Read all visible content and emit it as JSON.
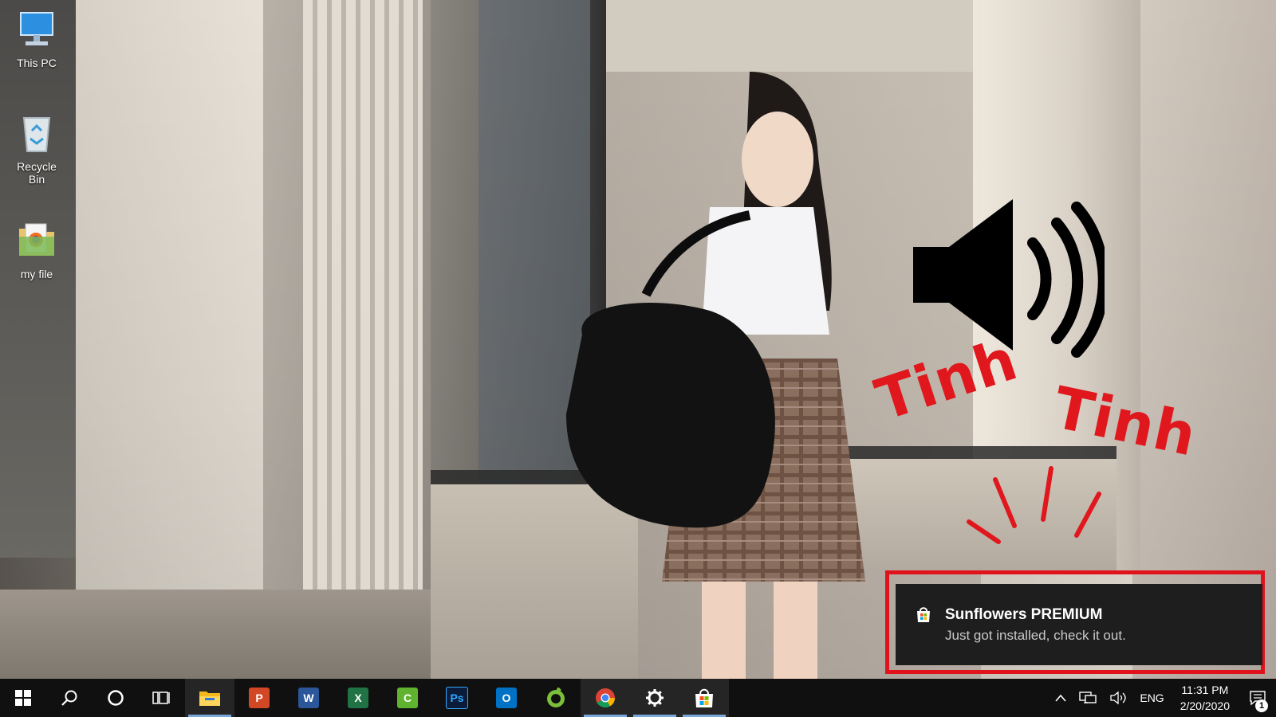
{
  "desktop": {
    "icons": [
      {
        "label": "This PC",
        "icon": "monitor-icon"
      },
      {
        "label": "Recycle Bin",
        "icon": "recycle-bin-icon"
      },
      {
        "label": "my file",
        "icon": "folder-icon"
      }
    ]
  },
  "overlay": {
    "speaker_icon": "speaker-volume-icon",
    "sound_left": "Tinh",
    "sound_right": "Tinh",
    "accent": "#e0181e"
  },
  "toast": {
    "app_icon": "microsoft-store-icon",
    "title": "Sunflowers PREMIUM",
    "body": "Just got installed, check it out.",
    "highlight": "#e0121c"
  },
  "taskbar": {
    "start": "windows-start-icon",
    "search": "search-icon",
    "cortana": "cortana-icon",
    "task_view": "task-view-icon",
    "apps": [
      {
        "name": "file-explorer",
        "short": "",
        "color": "#f3b91c",
        "active": true
      },
      {
        "name": "powerpoint",
        "short": "P",
        "color": "#d24726",
        "active": false
      },
      {
        "name": "word",
        "short": "W",
        "color": "#2b579a",
        "active": false
      },
      {
        "name": "excel",
        "short": "X",
        "color": "#217346",
        "active": false
      },
      {
        "name": "camtasia",
        "short": "C",
        "color": "#5fb32e",
        "active": false
      },
      {
        "name": "photoshop",
        "short": "Ps",
        "color": "#0b1b3a",
        "active": false
      },
      {
        "name": "outlook",
        "short": "O",
        "color": "#0072c6",
        "active": false
      },
      {
        "name": "coc-coc",
        "short": "",
        "color": "#7cbf3b",
        "active": false
      },
      {
        "name": "chrome",
        "short": "",
        "color": "#db4437",
        "active": true
      },
      {
        "name": "settings",
        "short": "",
        "color": "#ffffff",
        "active": true
      },
      {
        "name": "microsoft-store",
        "short": "",
        "color": "#ffffff",
        "active": true
      }
    ],
    "tray": {
      "language": "ENG",
      "time": "11:31 PM",
      "date": "2/20/2020",
      "notification_count": "1"
    }
  }
}
